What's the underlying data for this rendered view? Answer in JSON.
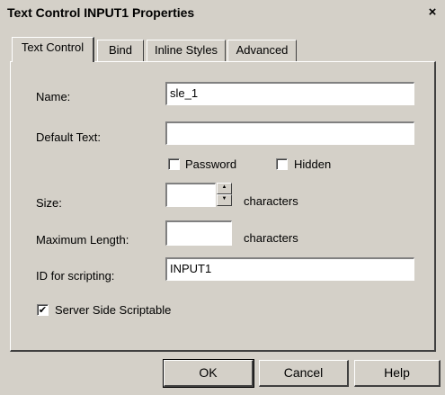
{
  "window": {
    "title": "Text Control INPUT1 Properties",
    "close_glyph": "×"
  },
  "tabs": [
    {
      "label": "Text Control",
      "active": true
    },
    {
      "label": "Bind",
      "active": false
    },
    {
      "label": "Inline Styles",
      "active": false
    },
    {
      "label": "Advanced",
      "active": false
    }
  ],
  "form": {
    "name_label": "Name:",
    "name_value": "sle_1",
    "default_text_label": "Default Text:",
    "default_text_value": "",
    "password_label": "Password",
    "password_checked": false,
    "hidden_label": "Hidden",
    "hidden_checked": false,
    "size_label": "Size:",
    "size_value": "",
    "size_unit": "characters",
    "maxlen_label": "Maximum Length:",
    "maxlen_value": "",
    "maxlen_unit": "characters",
    "id_label": "ID for scripting:",
    "id_value": "INPUT1",
    "server_label": "Server Side Scriptable",
    "server_checked": true,
    "check_glyph": "✔"
  },
  "buttons": {
    "ok": "OK",
    "cancel": "Cancel",
    "help": "Help"
  },
  "icons": {
    "spin_up": "▲",
    "spin_down": "▼"
  }
}
